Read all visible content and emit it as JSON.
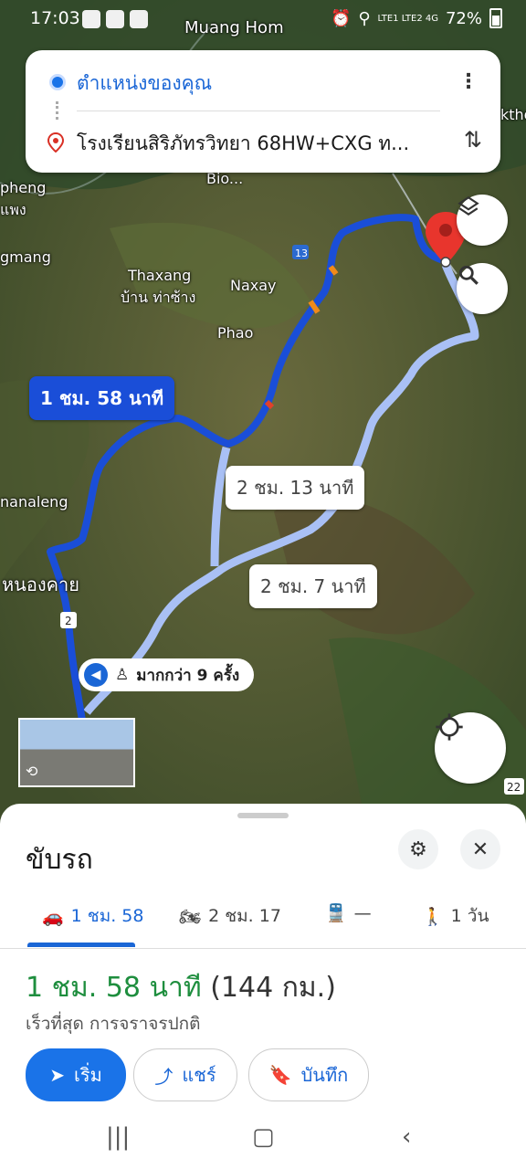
{
  "status_bar": {
    "time": "17:03",
    "signal": "LTE1 LTE2 4G",
    "battery": "72%"
  },
  "map": {
    "places": [
      {
        "label": "Muang Hom"
      },
      {
        "label": "Thaxang"
      },
      {
        "label": "บ้าน ท่าซ้าง"
      },
      {
        "label": "Naxay"
      },
      {
        "label": "Phao"
      },
      {
        "label": "pheng"
      },
      {
        "label": "แพง"
      },
      {
        "label": "gmang"
      },
      {
        "label": "nanaleng"
      },
      {
        "label": "หนองคาย"
      },
      {
        "label": "Bio..."
      },
      {
        "label": "ktho"
      }
    ],
    "road_shields": [
      "13",
      "2",
      "22"
    ],
    "route_labels": {
      "selected": "1 ชม. 58 นาที",
      "alt1": "2 ชม. 13 นาที",
      "alt2": "2 ชม. 7 นาที"
    },
    "traffic_report": "มากกว่า 9 ครั้ง",
    "icons": {
      "layers": "layers-icon",
      "search": "search-icon",
      "locate": "my-location-icon",
      "pin": "map-pin-icon"
    }
  },
  "route_card": {
    "origin": "ตำแหน่งของคุณ",
    "destination": "โรงเรียนสิริภัทรวิทยา 68HW+CXG ท..."
  },
  "sheet": {
    "title": "ขับรถ",
    "modes": [
      {
        "icon": "car-icon",
        "label": "1 ชม. 58",
        "active": true
      },
      {
        "icon": "motorcycle-icon",
        "label": "2 ชม. 17"
      },
      {
        "icon": "transit-icon",
        "label": "—"
      },
      {
        "icon": "walk-icon",
        "label": "1 วัน"
      }
    ],
    "eta": "1 ชม. 58 นาที",
    "distance": "(144 กม.)",
    "subtitle": "เร็วที่สุด การจราจรปกติ",
    "buttons": {
      "start": "เริ่ม",
      "share": "แชร์",
      "save": "บันทึก"
    }
  },
  "colors": {
    "route_main": "#1a4ed8",
    "route_alt": "#a9c0f5",
    "accent": "#1a73e8",
    "eta_green": "#1e8e3e"
  }
}
